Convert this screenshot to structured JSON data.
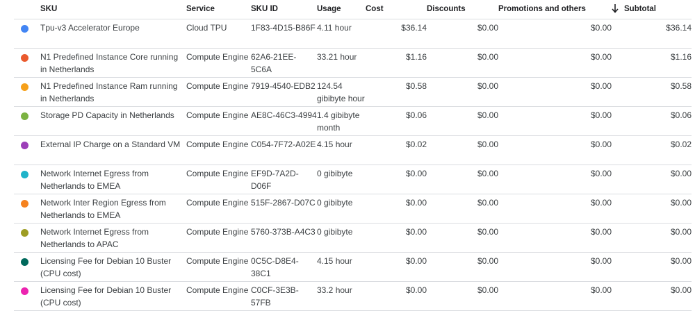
{
  "columns": {
    "sku": "SKU",
    "service": "Service",
    "sku_id": "SKU ID",
    "usage": "Usage",
    "cost": "Cost",
    "discounts": "Discounts",
    "promotions": "Promotions and others",
    "subtotal": "Subtotal"
  },
  "sort_icon": "arrow-down-icon",
  "rows": [
    {
      "color": "#4285f4",
      "sku": "Tpu-v3 Accelerator Europe",
      "service": "Cloud TPU",
      "sku_id": "1F83-4D15-B86F",
      "usage": "4.11 hour",
      "cost": "$36.14",
      "discounts": "$0.00",
      "promotions": "$0.00",
      "subtotal": "$36.14"
    },
    {
      "color": "#ea5a2d",
      "sku": "N1 Predefined Instance Core running in Netherlands",
      "service": "Compute Engine",
      "sku_id": "62A6-21EE-5C6A",
      "usage": "33.21 hour",
      "cost": "$1.16",
      "discounts": "$0.00",
      "promotions": "$0.00",
      "subtotal": "$1.16"
    },
    {
      "color": "#f6a01a",
      "sku": "N1 Predefined Instance Ram running in Netherlands",
      "service": "Compute Engine",
      "sku_id": "7919-4540-EDB2",
      "usage": "124.54 gibibyte hour",
      "cost": "$0.58",
      "discounts": "$0.00",
      "promotions": "$0.00",
      "subtotal": "$0.58"
    },
    {
      "color": "#7cb342",
      "sku": "Storage PD Capacity in Netherlands",
      "service": "Compute Engine",
      "sku_id": "AE8C-46C3-4994",
      "usage": "1.4 gibibyte month",
      "cost": "$0.06",
      "discounts": "$0.00",
      "promotions": "$0.00",
      "subtotal": "$0.06"
    },
    {
      "color": "#9c3fb8",
      "sku": "External IP Charge on a Standard VM",
      "service": "Compute Engine",
      "sku_id": "C054-7F72-A02E",
      "usage": "4.15 hour",
      "cost": "$0.02",
      "discounts": "$0.00",
      "promotions": "$0.00",
      "subtotal": "$0.02"
    },
    {
      "color": "#1fb3c9",
      "sku": "Network Internet Egress from Netherlands to EMEA",
      "service": "Compute Engine",
      "sku_id": "EF9D-7A2D-D06F",
      "usage": "0 gibibyte",
      "cost": "$0.00",
      "discounts": "$0.00",
      "promotions": "$0.00",
      "subtotal": "$0.00"
    },
    {
      "color": "#f5821f",
      "sku": "Network Inter Region Egress from Netherlands to EMEA",
      "service": "Compute Engine",
      "sku_id": "515F-2867-D07C",
      "usage": "0 gibibyte",
      "cost": "$0.00",
      "discounts": "$0.00",
      "promotions": "$0.00",
      "subtotal": "$0.00"
    },
    {
      "color": "#9e9d24",
      "sku": "Network Internet Egress from Netherlands to APAC",
      "service": "Compute Engine",
      "sku_id": "5760-373B-A4C3",
      "usage": "0 gibibyte",
      "cost": "$0.00",
      "discounts": "$0.00",
      "promotions": "$0.00",
      "subtotal": "$0.00"
    },
    {
      "color": "#00695c",
      "sku": "Licensing Fee for Debian 10 Buster (CPU cost)",
      "service": "Compute Engine",
      "sku_id": "0C5C-D8E4-38C1",
      "usage": "4.15 hour",
      "cost": "$0.00",
      "discounts": "$0.00",
      "promotions": "$0.00",
      "subtotal": "$0.00"
    },
    {
      "color": "#ec24b0",
      "sku": "Licensing Fee for Debian 10 Buster (CPU cost)",
      "service": "Compute Engine",
      "sku_id": "C0CF-3E3B-57FB",
      "usage": "33.2 hour",
      "cost": "$0.00",
      "discounts": "$0.00",
      "promotions": "$0.00",
      "subtotal": "$0.00"
    }
  ]
}
